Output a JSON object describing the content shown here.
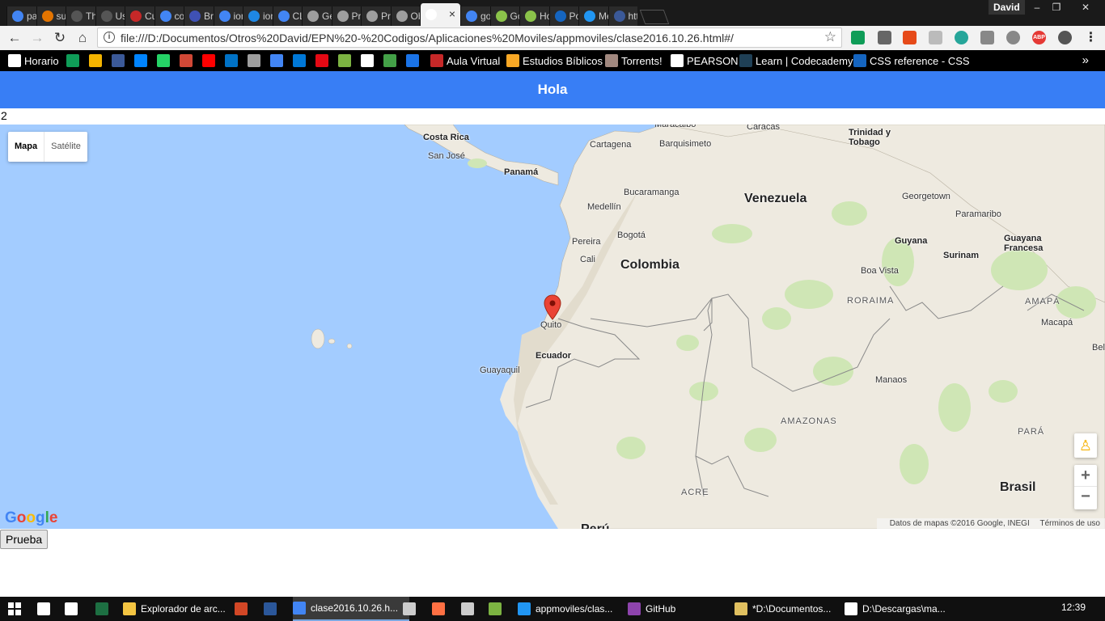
{
  "browser": {
    "tabs": [
      {
        "title": "pac",
        "fav": "#4285f4"
      },
      {
        "title": "sul",
        "fav": "#e37400"
      },
      {
        "title": "The",
        "fav": "#555555"
      },
      {
        "title": "Us",
        "fav": "#555555"
      },
      {
        "title": "Cu",
        "fav": "#c62828"
      },
      {
        "title": "cor",
        "fav": "#4285f4"
      },
      {
        "title": "Bra",
        "fav": "#3f51b5"
      },
      {
        "title": "ion",
        "fav": "#4285f4"
      },
      {
        "title": "ion",
        "fav": "#1e88e5"
      },
      {
        "title": "CL",
        "fav": "#4285f4"
      },
      {
        "title": "Ge",
        "fav": "#9e9e9e"
      },
      {
        "title": "Pru",
        "fav": "#9e9e9e"
      },
      {
        "title": "Pri",
        "fav": "#9e9e9e"
      },
      {
        "title": "Ob",
        "fav": "#9e9e9e"
      },
      {
        "title": "",
        "fav": "#ffffff",
        "active": true
      },
      {
        "title": "goo",
        "fav": "#4285f4"
      },
      {
        "title": "Go",
        "fav": "#8bc34a"
      },
      {
        "title": "Ho",
        "fav": "#8bc34a"
      },
      {
        "title": "Por",
        "fav": "#1565c0"
      },
      {
        "title": "Me",
        "fav": "#2196f3"
      },
      {
        "title": "htt",
        "fav": "#3b5998"
      }
    ],
    "profile_name": "David",
    "url": "file:///D:/Documentos/Otros%20David/EPN%20-%20Codigos/Aplicaciones%20Moviles/appmoviles/clase2016.10.26.html#/",
    "bookmarks": [
      {
        "label": "Horario",
        "color": "#ffffff"
      },
      {
        "label": "",
        "color": "#0f9d58"
      },
      {
        "label": "",
        "color": "#f4b400"
      },
      {
        "label": "",
        "color": "#3b5998"
      },
      {
        "label": "",
        "color": "#0084ff"
      },
      {
        "label": "",
        "color": "#25d366"
      },
      {
        "label": "",
        "color": "#d14836"
      },
      {
        "label": "",
        "color": "#ff0000"
      },
      {
        "label": "",
        "color": "#0072c6"
      },
      {
        "label": "",
        "color": "#9e9e9e"
      },
      {
        "label": "",
        "color": "#4285f4"
      },
      {
        "label": "",
        "color": "#0078d7"
      },
      {
        "label": "",
        "color": "#e50914"
      },
      {
        "label": "",
        "color": "#7cb342"
      },
      {
        "label": "",
        "color": "#ffffff"
      },
      {
        "label": "",
        "color": "#43a047"
      },
      {
        "label": "",
        "color": "#1a73e8"
      },
      {
        "label": "Aula Virtual",
        "color": "#c62828"
      },
      {
        "label": "Estudios Bíblicos",
        "color": "#f9a825"
      },
      {
        "label": "Torrents!",
        "color": "#a1887f"
      },
      {
        "label": "PEARSON",
        "color": "#ffffff"
      },
      {
        "label": "Learn | Codecademy",
        "color": "#1f4056"
      },
      {
        "label": "CSS reference - CSS",
        "color": "#1565c0"
      }
    ]
  },
  "page": {
    "header_title": "Hola",
    "counter": "2",
    "button_label": "Prueba"
  },
  "map": {
    "map_type_options": [
      "Mapa",
      "Satélite"
    ],
    "selected_map_type": "Mapa",
    "zoom_in_label": "+",
    "zoom_out_label": "−",
    "attribution": "Datos de mapas ©2016 Google, INEGI",
    "terms": "Términos de uso",
    "logo": "Google",
    "marker_label": "Quito",
    "labels": {
      "countries": [
        "Colombia",
        "Venezuela",
        "Ecuador",
        "Brasil",
        "Panamá",
        "Guyana",
        "Surinam",
        "Guayana Francesa",
        "Costa Rica",
        "Trinidad y Tobago",
        "Perú"
      ],
      "regions": [
        "RORAIMA",
        "AMAPÁ",
        "AMAZONAS",
        "PARÁ",
        "ACRE"
      ],
      "cities": [
        "Maracaibo",
        "Caracas",
        "Cartagena",
        "Barquisimeto",
        "San José",
        "Bucaramanga",
        "Georgetown",
        "Medellín",
        "Paramaribo",
        "Bogotá",
        "Pereira",
        "Cali",
        "Boa Vista",
        "Macapá",
        "Guayaquil",
        "Manaos",
        "Belé"
      ]
    }
  },
  "taskbar": {
    "items": [
      {
        "label": "",
        "color": "#ffffff"
      },
      {
        "label": "",
        "color": "#ffffff"
      },
      {
        "label": "",
        "color": "#ffffff"
      },
      {
        "label": "",
        "color": "#1d6f42"
      },
      {
        "label": "Explorador de arc...",
        "color": "#f4c542"
      },
      {
        "label": "",
        "color": "#d24726"
      },
      {
        "label": "",
        "color": "#2b579a"
      },
      {
        "label": "clase2016.10.26.h...",
        "color": "#4285f4"
      },
      {
        "label": "",
        "color": "#cccccc"
      },
      {
        "label": "",
        "color": "#ff7043"
      },
      {
        "label": "",
        "color": "#cccccc"
      },
      {
        "label": "",
        "color": "#7cb342"
      },
      {
        "label": "appmoviles/clas...",
        "color": "#2196f3"
      },
      {
        "label": "GitHub",
        "color": "#8e44ad"
      },
      {
        "label": "*D:\\Documentos...",
        "color": "#e0c060"
      },
      {
        "label": "D:\\Descargas\\ma...",
        "color": "#ffffff"
      }
    ],
    "clock": "12:39"
  }
}
